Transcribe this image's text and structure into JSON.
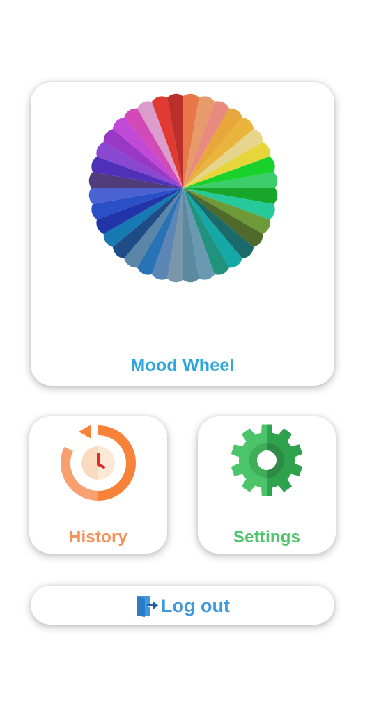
{
  "mood_wheel": {
    "label": "Mood Wheel",
    "icon": "color-wheel-icon",
    "colors": [
      "#e8774a",
      "#e79a6a",
      "#e88b7e",
      "#e8a73a",
      "#e9b53c",
      "#e6d58c",
      "#e6d63a",
      "#18d12a",
      "#3ccc6a",
      "#18a62a",
      "#25c99a",
      "#6f9a3a",
      "#4f6a2a",
      "#1a6a6a",
      "#15a8a6",
      "#20927e",
      "#6a9ab2",
      "#5a8aa0",
      "#7a96aa",
      "#5c86b6",
      "#2a72b6",
      "#5b86a8",
      "#1f4b86",
      "#187ab2",
      "#2234aa",
      "#2a50c8",
      "#4a62d2",
      "#503c7a",
      "#4f30b8",
      "#8a48d2",
      "#9a38c6",
      "#c04ad6",
      "#d24ab8",
      "#dc9ccc",
      "#e03a32",
      "#bb2f2a"
    ]
  },
  "history": {
    "label": "History",
    "icon": "history-clock-icon",
    "colors": {
      "ring": "#f98239",
      "ring_light": "#f9a070",
      "face": "#f9dcc0",
      "hand": "#e02a2a"
    }
  },
  "settings": {
    "label": "Settings",
    "icon": "gear-icon",
    "colors": {
      "light": "#4cc56a",
      "dark": "#2fa24e",
      "hole": "#ffffff"
    }
  },
  "logout": {
    "label": "Log out",
    "icon": "logout-door-icon",
    "color": "#4298de"
  }
}
